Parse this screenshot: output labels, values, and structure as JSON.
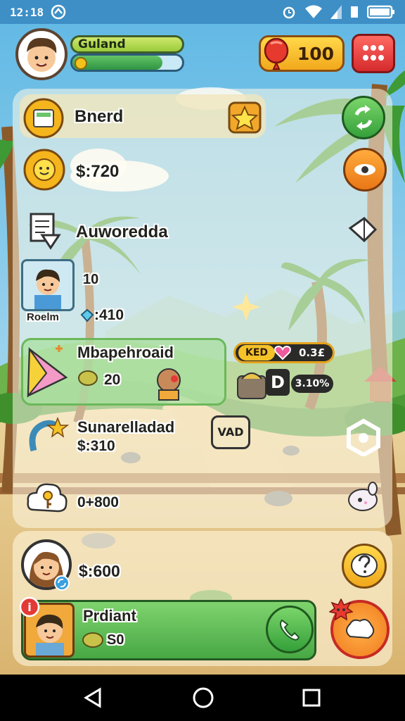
{
  "status_bar": {
    "time": "12:18"
  },
  "player": {
    "name": "Guland",
    "xp_progress": 0.82
  },
  "currency": {
    "gems": "100"
  },
  "rows": [
    {
      "label": "Bnerd"
    },
    {
      "label": "$:720"
    },
    {
      "label": "Auworedda"
    },
    {
      "card_name": "Roelm",
      "level": "10",
      "gems": ":410"
    },
    {
      "label": "Mbapehroaid",
      "value": "20"
    },
    {
      "label": "Sunarelladad",
      "value": "$:310",
      "bubble": "VAD"
    },
    {
      "value": "0+800"
    }
  ],
  "market": {
    "tag_label": "KED",
    "tag_value": "0.3£",
    "stock_letter": "D",
    "stock_value": "3.10%"
  },
  "footer": {
    "balance": "$:600",
    "friend_name": "Prdiant",
    "friend_value": "S0"
  },
  "colors": {
    "status_bar": "#3d8fc6",
    "panel": "#fffae8",
    "accent_green": "#4fb84d",
    "accent_orange": "#f28a1e",
    "accent_red": "#e23a36"
  },
  "icons": [
    "sync-icon",
    "eye-icon",
    "share-icon",
    "hexagon-icon",
    "question-icon",
    "fire-icon",
    "phone-icon",
    "star-icon",
    "heart-icon",
    "trophy-icon"
  ]
}
